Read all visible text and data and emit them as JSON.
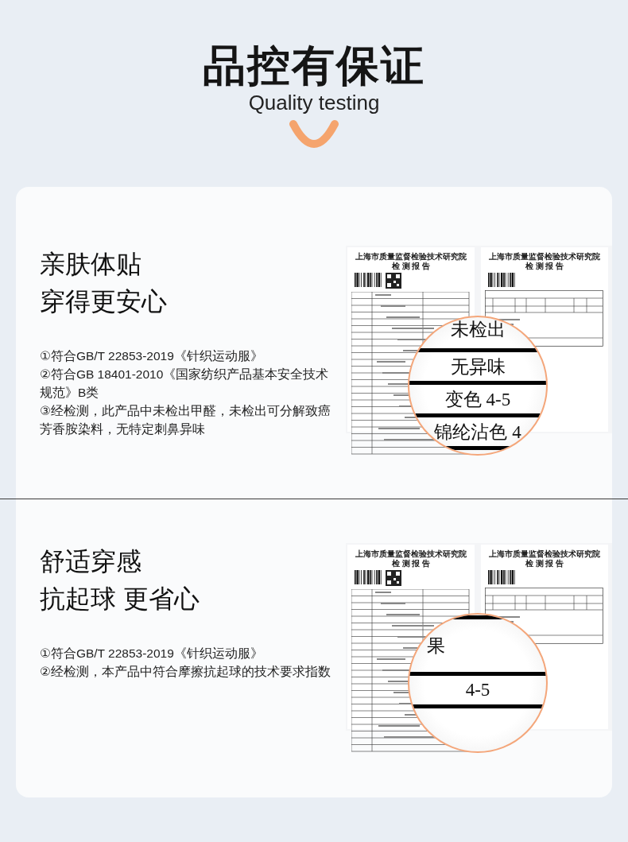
{
  "header": {
    "title": "品控有保证",
    "subtitle": "Quality testing"
  },
  "sections": [
    {
      "heading_lines": [
        "亲肤体贴",
        "穿得更安心"
      ],
      "points": [
        "①符合GB/T 22853-2019《针织运动服》",
        "②符合GB 18401-2010《国家纺织产品基本安全技术规范》B类",
        "③经检测，此产品中未检出甲醛，未检出可分解致癌芳香胺染料，无特定刺鼻异味"
      ],
      "reports": [
        {
          "kind": "cover",
          "institute": "上海市质量监督检验技术研究院",
          "title": "检 测 报 告"
        },
        {
          "kind": "results",
          "institute": "上海市质量监督检验技术研究院",
          "title": "检 测 报 告"
        }
      ],
      "magnifier": {
        "top_rule": false,
        "rows": [
          {
            "kind": "value",
            "text": "未检出"
          },
          {
            "kind": "value",
            "text": "无异味"
          },
          {
            "kind": "value",
            "text": "变色 4-5"
          },
          {
            "kind": "value",
            "text": "锦纶沾色 4"
          }
        ]
      }
    },
    {
      "heading_lines": [
        "舒适穿感",
        "抗起球 更省心"
      ],
      "points": [
        "①符合GB/T 22853-2019《针织运动服》",
        "②经检测，本产品中符合摩擦抗起球的技术要求指数"
      ],
      "reports": [
        {
          "kind": "cover",
          "institute": "上海市质量监督检验技术研究院",
          "title": "检 测 报 告"
        },
        {
          "kind": "results",
          "institute": "上海市质量监督检验技术研究院",
          "title": "检 测 报 告"
        }
      ],
      "magnifier": {
        "top_rule": true,
        "rows": [
          {
            "kind": "label",
            "text": "果"
          },
          {
            "kind": "value",
            "text": "4-5"
          }
        ]
      }
    }
  ]
}
